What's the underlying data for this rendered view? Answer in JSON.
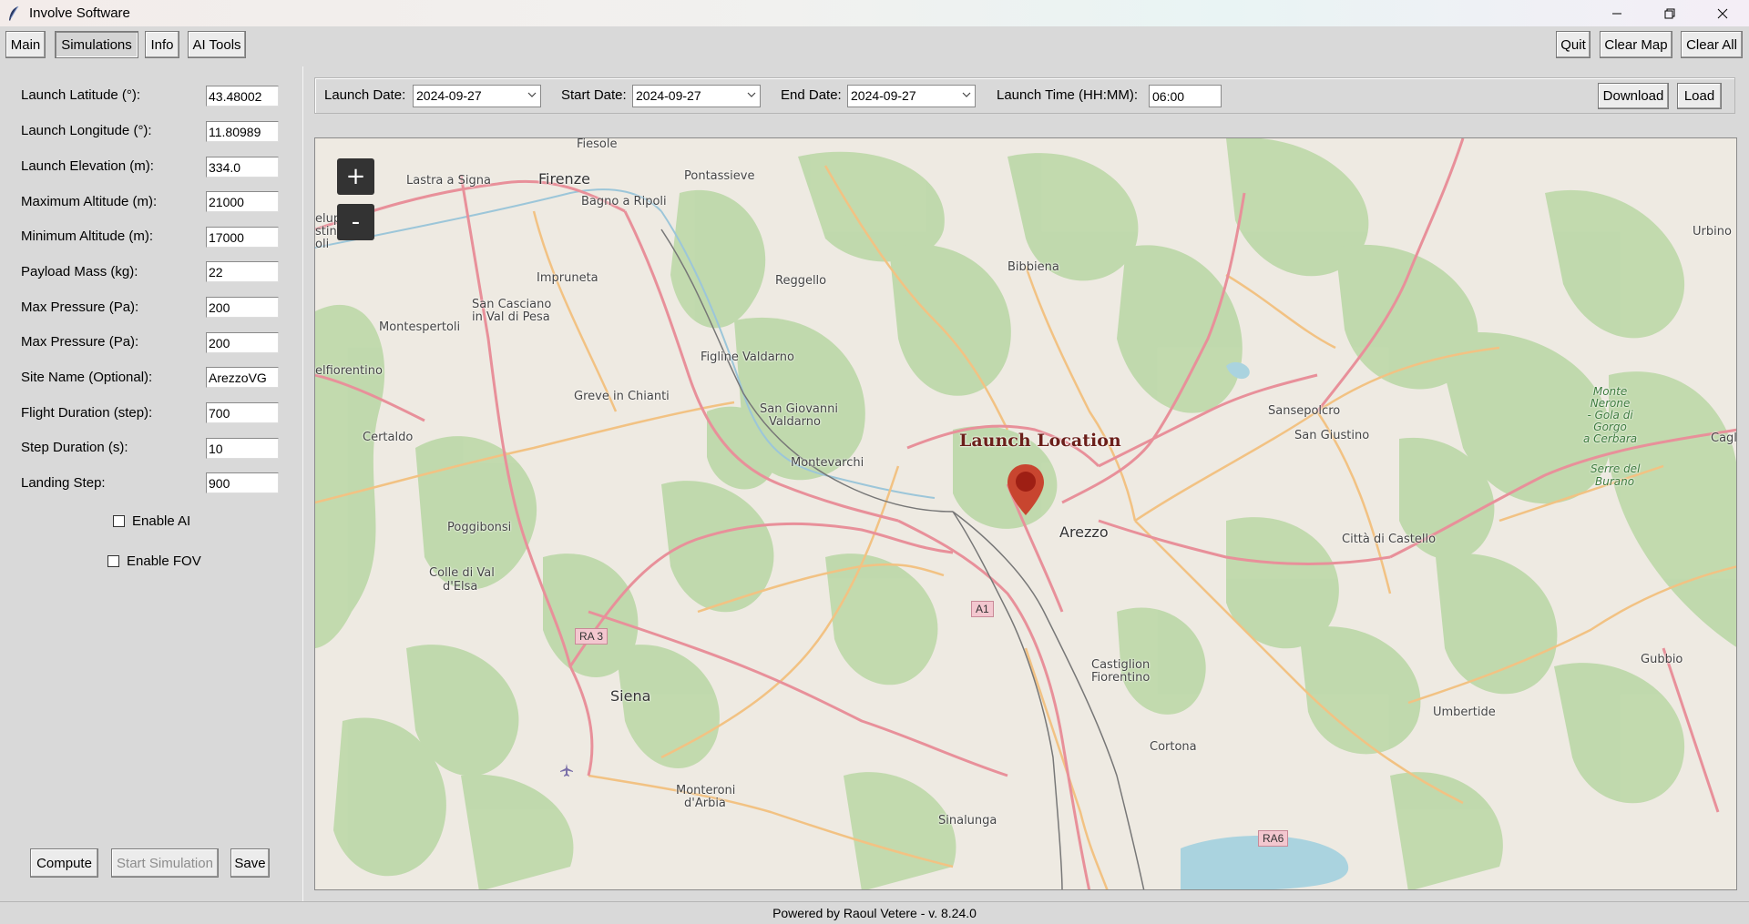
{
  "window": {
    "title": "Involve Software",
    "controls": [
      "minimize-icon",
      "restore-icon",
      "close-icon"
    ]
  },
  "toolbar": {
    "tabs": [
      {
        "label": "Main",
        "active": false
      },
      {
        "label": "Simulations",
        "active": true
      },
      {
        "label": "Info",
        "active": false
      },
      {
        "label": "AI Tools",
        "active": false
      }
    ],
    "quit_label": "Quit",
    "clear_map_label": "Clear Map",
    "clear_all_label": "Clear All"
  },
  "parameters": [
    {
      "label": "Launch Latitude (°):",
      "value": "43.48002"
    },
    {
      "label": "Launch Longitude (°):",
      "value": "11.80989"
    },
    {
      "label": "Launch Elevation (m):",
      "value": "334.0"
    },
    {
      "label": "Maximum Altitude (m):",
      "value": "21000"
    },
    {
      "label": "Minimum Altitude (m):",
      "value": "17000"
    },
    {
      "label": "Payload Mass (kg):",
      "value": "22"
    },
    {
      "label": "Max Pressure (Pa):",
      "value": "200"
    },
    {
      "label": "Max Pressure (Pa):",
      "value": "200"
    },
    {
      "label": "Site Name (Optional):",
      "value": "ArezzoVG"
    },
    {
      "label": "Flight Duration (step):",
      "value": "700"
    },
    {
      "label": "Step Duration (s):",
      "value": "10"
    },
    {
      "label": "Landing Step:",
      "value": "900"
    }
  ],
  "options": {
    "enable_ai": {
      "label": "Enable AI",
      "checked": false
    },
    "enable_fov": {
      "label": "Enable FOV",
      "checked": false
    }
  },
  "actions": {
    "compute_label": "Compute",
    "start_simulation_label": "Start Simulation",
    "save_label": "Save"
  },
  "dates": {
    "launch_date_label": "Launch Date:",
    "launch_date_value": "2024-09-27",
    "start_date_label": "Start Date:",
    "start_date_value": "2024-09-27",
    "end_date_label": "End Date:",
    "end_date_value": "2024-09-27",
    "launch_time_label": "Launch Time (HH:MM):",
    "launch_time_value": "06:00",
    "download_label": "Download",
    "load_label": "Load"
  },
  "map": {
    "zoom_in_label": "+",
    "zoom_out_label": "-",
    "marker_label": "Launch Location",
    "places": {
      "fiesole": "Fiesole",
      "lastra": "Lastra a Signa",
      "firenze": "Firenze",
      "pontassieve": "Pontassieve",
      "bagno": "Bagno a Ripoli",
      "campo": "elupo",
      "campo2": "stino",
      "scandicci": "oli",
      "impruneta": "Impruneta",
      "reggello": "Reggello",
      "bibbiena": "Bibbiena",
      "urbino": "Urbino",
      "sancasciano1": "San Casciano",
      "sancasciano2": "in Val di Pesa",
      "montespertoli": "Montespertoli",
      "figline": "Figline Valdarno",
      "castelfiorentino": "elfiorentino",
      "greve": "Greve in Chianti",
      "sangiovanni1": "San Giovanni",
      "sangiovanni2": "Valdarno",
      "certaldo": "Certaldo",
      "montevarchi": "Montevarchi",
      "sansepolcro": "Sansepolcro",
      "sangiustino": "San Giustino",
      "cagli": "Cagli",
      "arezzo": "Arezzo",
      "poggibonsi": "Poggibonsi",
      "colle1": "Colle di Val",
      "colle2": "d'Elsa",
      "cittadicastello": "Città di Castello",
      "siena": "Siena",
      "castiglion1": "Castiglion",
      "castiglion2": "Fiorentino",
      "gubbio": "Gubbio",
      "umbertide": "Umbertide",
      "cortona": "Cortona",
      "monteroni1": "Monteroni",
      "monteroni2": "d'Arbia",
      "sinalunga": "Sinalunga",
      "montenerone": "Monte\nNerone\n- Gola di\nGorgo\na Cerbara",
      "serre1": "Serre del",
      "serre2": "Burano"
    },
    "shields": {
      "ra3": "RA 3",
      "a1": "A1",
      "ra6": "RA6"
    }
  },
  "footer": {
    "text": "Powered by Raoul Vetere - v. 8.24.0"
  },
  "colors": {
    "window_bg": "#d9d9d9",
    "map_land": "#eeeae2",
    "forest": "#b5d3a0",
    "primary_road": "#e8909a",
    "secondary_road": "#f2c283",
    "marker": "#c0392b",
    "lake": "#aad3df"
  }
}
